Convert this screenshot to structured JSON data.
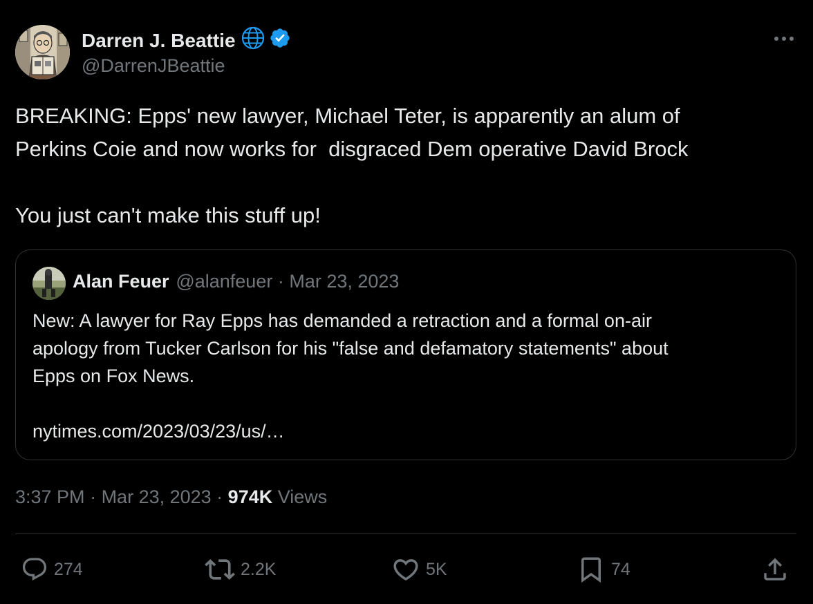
{
  "author": {
    "name": "Darren J. Beattie",
    "handle": "@DarrenJBeattie"
  },
  "tweet": {
    "text": "BREAKING: Epps' new lawyer, Michael Teter, is apparently an alum of\nPerkins Coie and now works for  disgraced Dem operative David Brock\n\nYou just can't make this stuff up!"
  },
  "quote": {
    "name": "Alan Feuer",
    "handle": "@alanfeuer",
    "separator": " · ",
    "date": "Mar 23, 2023",
    "text": "New: A lawyer for Ray Epps has demanded a retraction and a formal on-air\napology from Tucker Carlson for his \"false and defamatory statements\" about\nEpps on Fox News.\n\nnytimes.com/2023/03/23/us/…"
  },
  "meta": {
    "time": "3:37 PM",
    "separator": " · ",
    "date": "Mar 23, 2023",
    "views_count": "974K",
    "views_label": " Views"
  },
  "actions": {
    "replies": "274",
    "reposts": "2.2K",
    "likes": "5K",
    "bookmarks": "74"
  },
  "colors": {
    "background": "#000000",
    "text": "#e7e9ea",
    "secondary": "#71767b",
    "border": "#2f3336",
    "verified": "#1d9bf0"
  },
  "icons": {
    "more": "more-horizontal-icon",
    "globe": "globe-icon",
    "verified": "verified-badge-icon",
    "reply": "reply-icon",
    "repost": "repost-icon",
    "like": "heart-icon",
    "bookmark": "bookmark-icon",
    "share": "share-icon"
  }
}
